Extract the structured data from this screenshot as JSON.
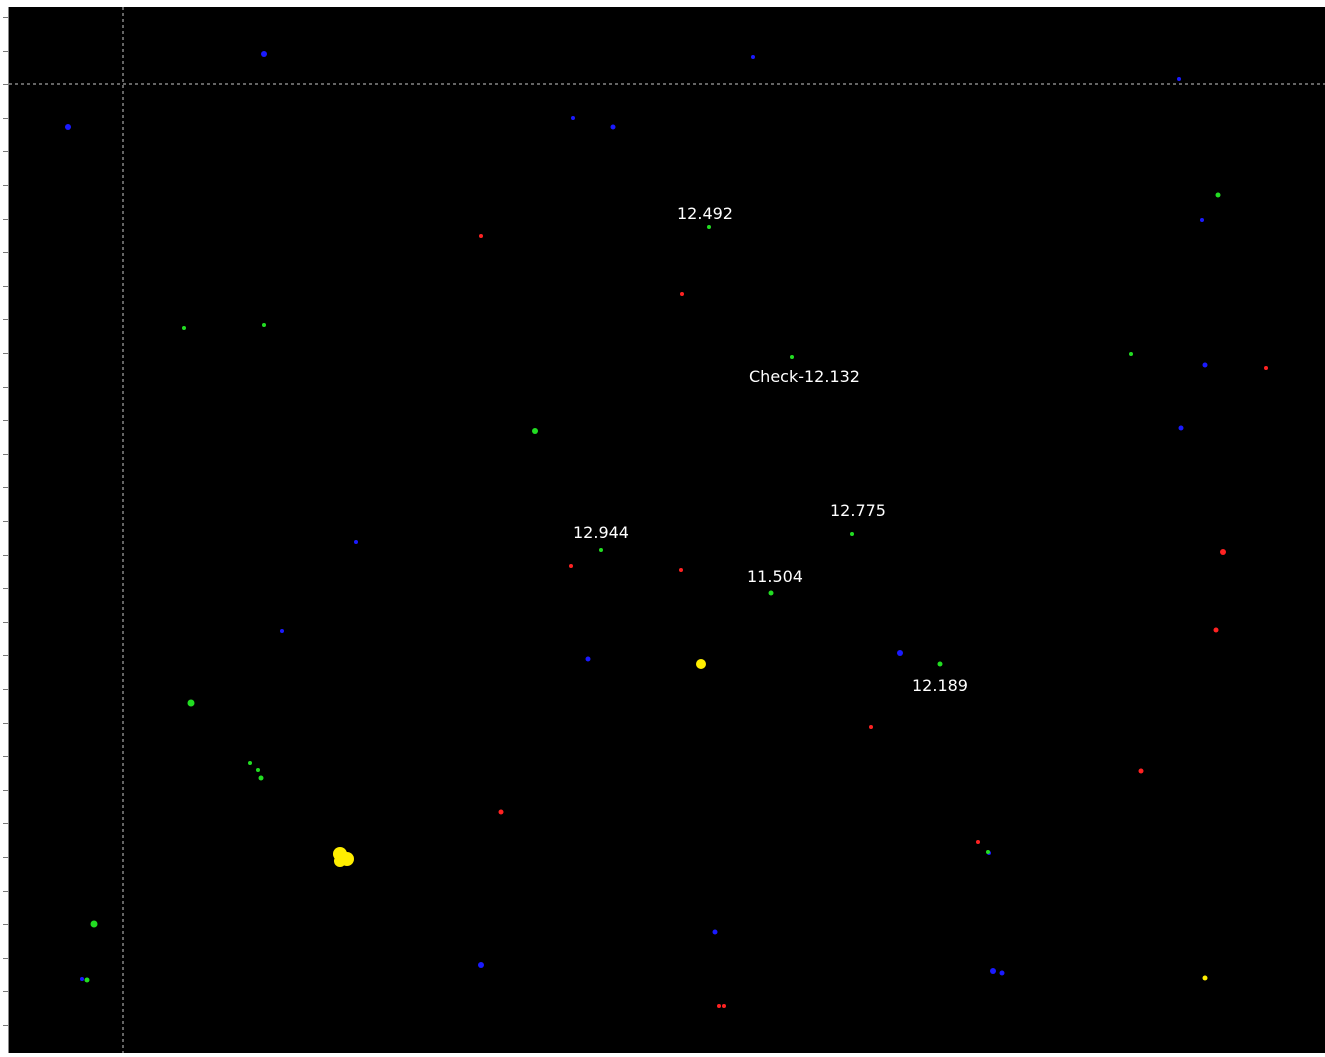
{
  "colors": {
    "background": "#000000",
    "crosshair": "#c8c8c8",
    "label": "#ffffff",
    "star_blue": "#1a1aff",
    "star_green": "#22dd22",
    "star_red": "#ff2222",
    "star_yellow": "#ffee00"
  },
  "labels": [
    {
      "text": "12.492"
    },
    {
      "text": "Check-12.132"
    },
    {
      "text": "12.775"
    },
    {
      "text": "12.944"
    },
    {
      "text": "11.504"
    },
    {
      "text": "12.189"
    }
  ],
  "star_colors": [
    "blue",
    "green",
    "red",
    "yellow"
  ]
}
